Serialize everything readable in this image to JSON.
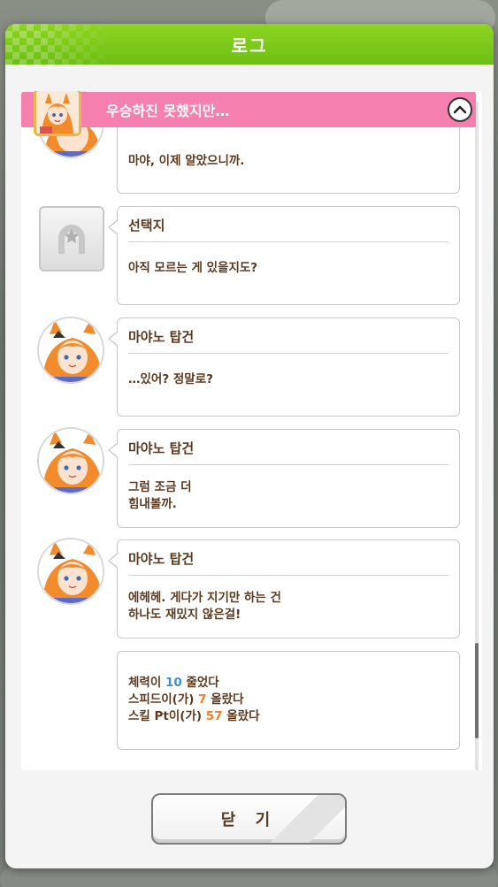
{
  "modal": {
    "title": "로그"
  },
  "banner": {
    "title": "우승하진 못했지만…",
    "collapse_icon": "chevron-up-icon"
  },
  "entries": [
    {
      "speaker": "",
      "lines": [
        "마야, 이제 알았으니까."
      ]
    },
    {
      "speaker": "선택지",
      "lines": [
        "아직 모르는 게 있을지도?"
      ]
    },
    {
      "speaker": "마야노 탑건",
      "lines": [
        "…있어? 정말로?"
      ]
    },
    {
      "speaker": "마야노 탑건",
      "lines": [
        "그럼 조금 더",
        "힘내볼까."
      ]
    },
    {
      "speaker": "마야노 탑건",
      "lines": [
        "에헤헤. 게다가 지기만 하는 건",
        "하나도 재밌지 않은걸!"
      ]
    }
  ],
  "result": {
    "lines": [
      {
        "prefix": "체력이 ",
        "value": "10",
        "suffix": " 줄었다"
      },
      {
        "prefix": "스피드이(가) ",
        "value": "7",
        "suffix": " 올랐다"
      },
      {
        "prefix": "스킬 Pt이(가) ",
        "value": "57",
        "suffix": " 올랐다"
      }
    ],
    "colors": {
      "decrease": "#3d8de0",
      "increase": "#f08030"
    }
  },
  "footer": {
    "close_label": "닫 기"
  },
  "colors": {
    "header_green": "#7cc81a",
    "banner_pink": "#f57fae",
    "text_brown": "#5b3a20"
  }
}
